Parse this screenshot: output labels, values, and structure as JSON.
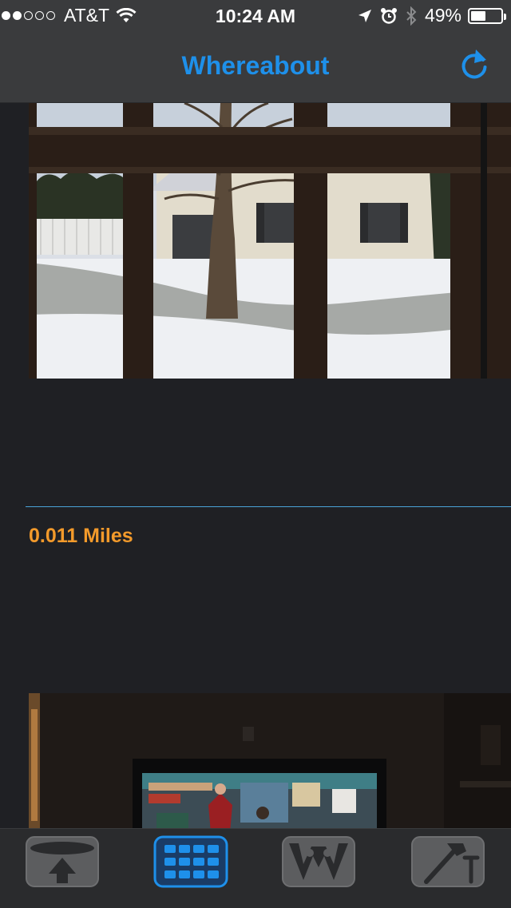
{
  "status_bar": {
    "carrier": "AT&T",
    "time": "10:24 AM",
    "battery_percent": "49%",
    "battery_level": 0.49,
    "signal_bars_filled": 2,
    "signal_bars_total": 5
  },
  "nav": {
    "title": "Whereabout",
    "refresh_icon": "refresh-icon",
    "accent_color": "#1e90ea"
  },
  "feed": {
    "items": [
      {
        "photo": "snowy-yard-through-window"
      },
      {
        "distance": "0.011 Miles",
        "photo": "living-room-tv"
      }
    ],
    "distance_color": "#f39a2b"
  },
  "tab_bar": {
    "tabs": [
      {
        "icon": "upload-icon",
        "active": false
      },
      {
        "icon": "grid-icon",
        "active": true
      },
      {
        "icon": "web-icon",
        "active": false
      },
      {
        "icon": "tools-icon",
        "active": false
      }
    ],
    "active_color": "#1e90ea"
  }
}
